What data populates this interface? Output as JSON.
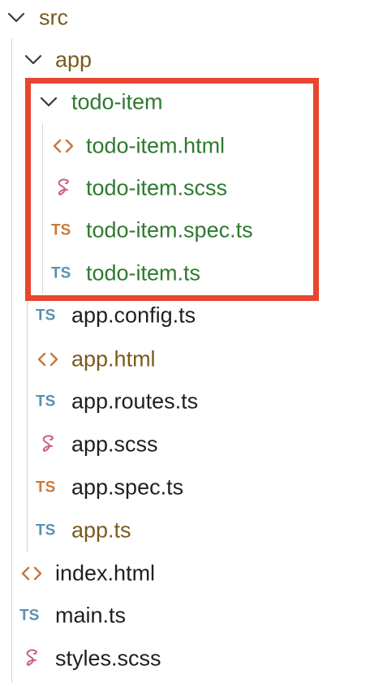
{
  "colors": {
    "ts_blue": "#5a8fb0",
    "ts_orange": "#c97a3a",
    "html_orange": "#c8753f",
    "sass_pink": "#cc5f7b",
    "text_default": "#1f1f1f",
    "text_modified": "#7a5a1c",
    "text_untracked": "#2e7a2e",
    "highlight_red": "#e8462e"
  },
  "tree": {
    "src": {
      "label": "src",
      "icon": "chevron-down-icon"
    },
    "app": {
      "label": "app",
      "icon": "chevron-down-icon"
    },
    "todo_item": {
      "label": "todo-item",
      "icon": "chevron-down-icon",
      "files": [
        {
          "label": "todo-item.html",
          "icon": "html-icon"
        },
        {
          "label": "todo-item.scss",
          "icon": "sass-icon"
        },
        {
          "label": "todo-item.spec.ts",
          "icon": "typescript-icon",
          "icon_text": "TS"
        },
        {
          "label": "todo-item.ts",
          "icon": "typescript-icon",
          "icon_text": "TS"
        }
      ]
    },
    "app_files": [
      {
        "label": "app.config.ts",
        "icon": "typescript-icon",
        "icon_text": "TS"
      },
      {
        "label": "app.html",
        "icon": "html-icon"
      },
      {
        "label": "app.routes.ts",
        "icon": "typescript-icon",
        "icon_text": "TS"
      },
      {
        "label": "app.scss",
        "icon": "sass-icon"
      },
      {
        "label": "app.spec.ts",
        "icon": "typescript-icon",
        "icon_text": "TS"
      },
      {
        "label": "app.ts",
        "icon": "typescript-icon",
        "icon_text": "TS"
      }
    ],
    "src_files": [
      {
        "label": "index.html",
        "icon": "html-icon"
      },
      {
        "label": "main.ts",
        "icon": "typescript-icon",
        "icon_text": "TS"
      },
      {
        "label": "styles.scss",
        "icon": "sass-icon"
      }
    ]
  }
}
